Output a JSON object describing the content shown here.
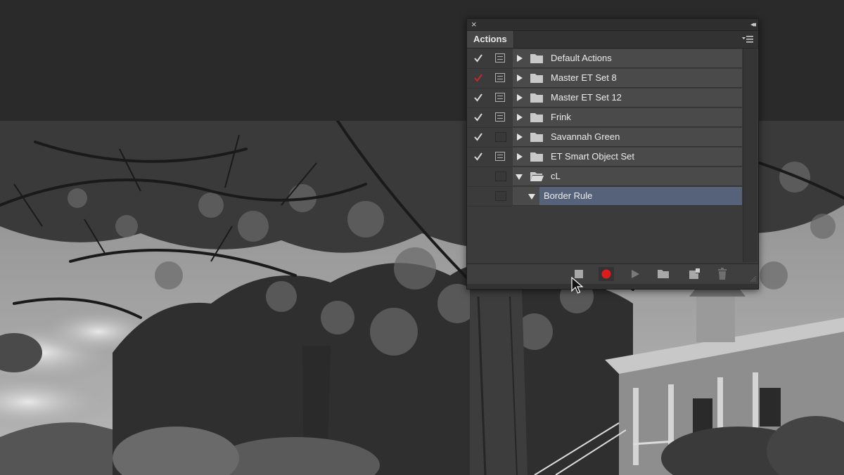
{
  "panel": {
    "tab_label": "Actions",
    "close_glyph": "×",
    "collapse_glyph": "◂◂",
    "rows": [
      {
        "label": "Default Actions",
        "checked": true,
        "check_color": "#d8d8d8",
        "dialog": true,
        "expanded": false
      },
      {
        "label": "Master ET Set 8",
        "checked": true,
        "check_color": "#c62828",
        "dialog": true,
        "expanded": false
      },
      {
        "label": "Master ET Set 12",
        "checked": true,
        "check_color": "#d8d8d8",
        "dialog": true,
        "expanded": false
      },
      {
        "label": "Frink",
        "checked": true,
        "check_color": "#d8d8d8",
        "dialog": true,
        "expanded": false
      },
      {
        "label": "Savannah Green",
        "checked": true,
        "check_color": "#d8d8d8",
        "dialog": false,
        "expanded": false
      },
      {
        "label": "ET Smart Object Set",
        "checked": true,
        "check_color": "#d8d8d8",
        "dialog": true,
        "expanded": false
      },
      {
        "label": "cL",
        "checked": false,
        "dialog": false,
        "expanded": true
      },
      {
        "label": "Border Rule",
        "checked": false,
        "dialog": false,
        "expanded": true,
        "selected": true
      }
    ],
    "footer_icons": [
      "stop-icon",
      "record-icon",
      "play-icon",
      "folder-icon",
      "new-action-icon",
      "trash-icon"
    ],
    "colors": {
      "record": "#e01b1b",
      "selection": "#56627a",
      "panel_bg": "#3c3c3c"
    }
  }
}
